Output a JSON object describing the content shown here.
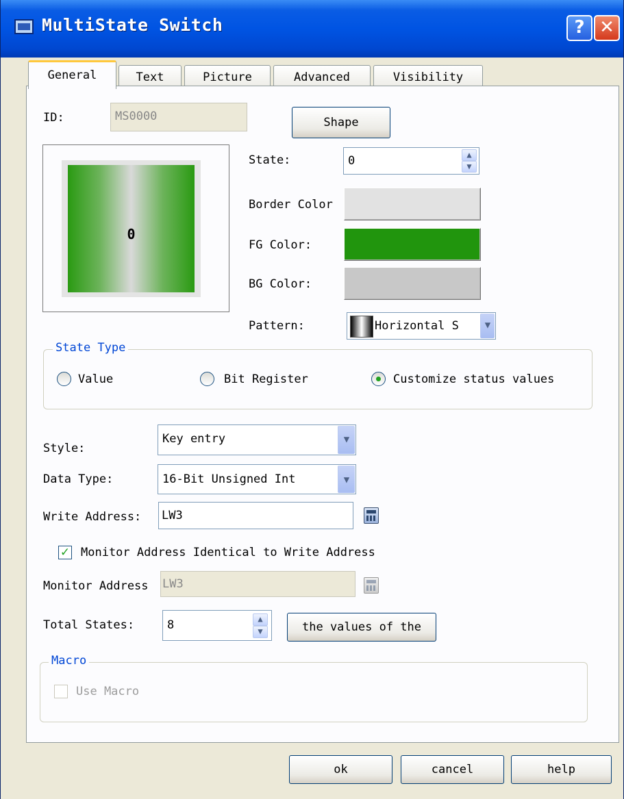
{
  "window": {
    "title": "MultiState Switch",
    "help_glyph": "?",
    "close_glyph": "✕"
  },
  "tabs": [
    {
      "label": "General",
      "active": true
    },
    {
      "label": "Text"
    },
    {
      "label": "Picture"
    },
    {
      "label": "Advanced"
    },
    {
      "label": "Visibility"
    }
  ],
  "general": {
    "id_label": "ID:",
    "id_value": "MS0000",
    "shape_button": "Shape",
    "preview_text": "0",
    "state_label": "State:",
    "state_value": "0",
    "border_color_label": "Border Color",
    "fg_color_label": "FG Color:",
    "bg_color_label": "BG Color:",
    "pattern_label": "Pattern:",
    "pattern_value": "Horizontal S",
    "colors": {
      "border": "#e0e0e0",
      "fg": "#21950d",
      "bg": "#c8c8c8"
    }
  },
  "state_type": {
    "title": "State Type",
    "options": [
      "Value",
      "Bit Register",
      "Customize status values"
    ],
    "selected": "Customize status values"
  },
  "style": {
    "label": "Style:",
    "value": "Key entry"
  },
  "data_type": {
    "label": "Data Type:",
    "value": "16-Bit Unsigned Int"
  },
  "write_address": {
    "label": "Write Address:",
    "value": "LW3"
  },
  "monitor_identical": {
    "label": "Monitor Address Identical to Write Address",
    "checked": true
  },
  "monitor_address": {
    "label": "Monitor Address",
    "value": "LW3"
  },
  "total_states": {
    "label": "Total States:",
    "value": "8",
    "button": "the values of the"
  },
  "macro": {
    "title": "Macro",
    "use_macro_label": "Use Macro",
    "checked": false
  },
  "footer": {
    "ok": "ok",
    "cancel": "cancel",
    "help": "help"
  }
}
